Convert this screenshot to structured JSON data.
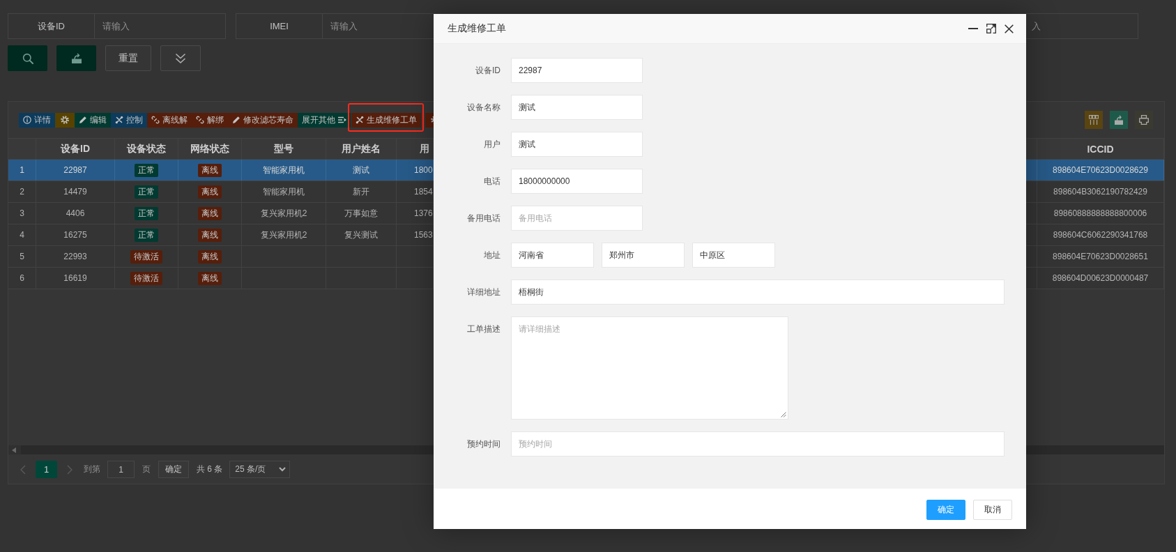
{
  "search_fields": [
    {
      "label": "设备ID",
      "placeholder": "请输入"
    },
    {
      "label": "IMEI",
      "placeholder": "请输入"
    },
    {
      "placeholder": "入"
    }
  ],
  "search_buttons": [
    {
      "kind": "search"
    },
    {
      "kind": "export"
    },
    {
      "kind": "reset",
      "label": "重置"
    },
    {
      "kind": "expand"
    }
  ],
  "toolbar": {
    "actions": [
      {
        "kind": "detail",
        "label": "详情",
        "color": "#0c3b5c",
        "highlighted": false
      },
      {
        "kind": "settings",
        "color": "#584200",
        "highlighted": false
      },
      {
        "kind": "edit",
        "label": "编辑",
        "color": "#003a30",
        "highlighted": false
      },
      {
        "kind": "control",
        "label": "控制",
        "color": "#0c3b5c",
        "highlighted": false
      },
      {
        "kind": "offline",
        "label": "离线解",
        "color": "#561e0b",
        "highlighted": false
      },
      {
        "kind": "unbind",
        "label": "解绑",
        "color": "#561e0b",
        "highlighted": false
      },
      {
        "kind": "filter",
        "label": "修改滤芯寿命",
        "color": "#561e0b",
        "highlighted": false
      },
      {
        "kind": "more",
        "label": "展开其他",
        "color": "#003a30",
        "highlighted": false
      },
      {
        "kind": "repair",
        "label": "生成维修工单",
        "color": "#561e0b",
        "highlighted": true
      },
      {
        "kind": "settings",
        "color": "#561e0b",
        "highlighted": false
      }
    ],
    "tools": [
      {
        "kind": "columns",
        "color": "#5a4410"
      },
      {
        "kind": "export",
        "color": "#1e5a4a"
      },
      {
        "kind": "print",
        "color": "#3b3a31"
      }
    ]
  },
  "table": {
    "columns": [
      {
        "label": "设备ID"
      },
      {
        "label": "设备状态"
      },
      {
        "label": "网络状态"
      },
      {
        "label": "型号"
      },
      {
        "label": "用户姓名"
      },
      {
        "label": "用"
      },
      {
        "label": "ICCID"
      }
    ],
    "rows": [
      {
        "number": "1",
        "device_id": "22987",
        "device_status": {
          "text": "正常",
          "color": "#003a30"
        },
        "network_status": {
          "text": "离线",
          "color": "#561e0b"
        },
        "model": "智能家用机",
        "user_name": "测试",
        "column_7": "1800",
        "iccid": "898604E70623D0028629",
        "selected": true
      },
      {
        "number": "2",
        "device_id": "14479",
        "device_status": {
          "text": "正常",
          "color": "#003a30"
        },
        "network_status": {
          "text": "离线",
          "color": "#561e0b"
        },
        "model": "智能家用机",
        "user_name": "新开",
        "column_7": "1854",
        "iccid": "898604B3062190782429",
        "selected": false
      },
      {
        "number": "3",
        "device_id": "4406",
        "device_status": {
          "text": "正常",
          "color": "#003a30"
        },
        "network_status": {
          "text": "离线",
          "color": "#561e0b"
        },
        "model": "复兴家用机2",
        "user_name": "万事如意",
        "column_7": "1376",
        "iccid": "89860888888888800006",
        "selected": false
      },
      {
        "number": "4",
        "device_id": "16275",
        "device_status": {
          "text": "正常",
          "color": "#003a30"
        },
        "network_status": {
          "text": "离线",
          "color": "#561e0b"
        },
        "model": "复兴家用机2",
        "user_name": "复兴测试",
        "column_7": "1563",
        "iccid": "898604C6062290341768",
        "selected": false
      },
      {
        "number": "5",
        "device_id": "22993",
        "device_status": {
          "text": "待激活",
          "color": "#561e0b"
        },
        "network_status": {
          "text": "离线",
          "color": "#561e0b"
        },
        "iccid": "898604E70623D0028651",
        "selected": false
      },
      {
        "number": "6",
        "device_id": "16619",
        "device_status": {
          "text": "待激活",
          "color": "#561e0b"
        },
        "network_status": {
          "text": "离线",
          "color": "#561e0b"
        },
        "iccid": "898604D00623D0000487",
        "selected": false
      }
    ]
  },
  "pagination": {
    "pages": [
      {
        "label": "1",
        "selected": true
      }
    ],
    "goto_label": "到第",
    "goto_value": "1",
    "goto_suffix": "页",
    "confirm": "确定",
    "total": "共 6 条",
    "page_size": "25 条/页"
  },
  "dialog": {
    "title": "生成维修工单",
    "fields": [
      {
        "kind": "short",
        "label": "设备ID",
        "value": "22987"
      },
      {
        "kind": "short",
        "label": "设备名称",
        "value": "测试"
      },
      {
        "kind": "short",
        "label": "用户",
        "value": "测试"
      },
      {
        "kind": "short",
        "label": "电话",
        "value": "18000000000"
      },
      {
        "kind": "short",
        "label": "备用电话",
        "placeholder": "备用电话"
      },
      {
        "kind": "address",
        "label": "地址",
        "values": [
          "河南省",
          "郑州市",
          "中原区"
        ]
      },
      {
        "kind": "wide",
        "label": "详细地址",
        "value": "梧桐街"
      },
      {
        "kind": "textarea",
        "label": "工单描述",
        "placeholder": "请详细描述"
      },
      {
        "kind": "wide",
        "label": "预约时间",
        "placeholder": "预约时间"
      }
    ],
    "buttons": [
      {
        "kind": "primary",
        "label": "确定"
      },
      {
        "kind": "default",
        "label": "取消"
      }
    ]
  }
}
